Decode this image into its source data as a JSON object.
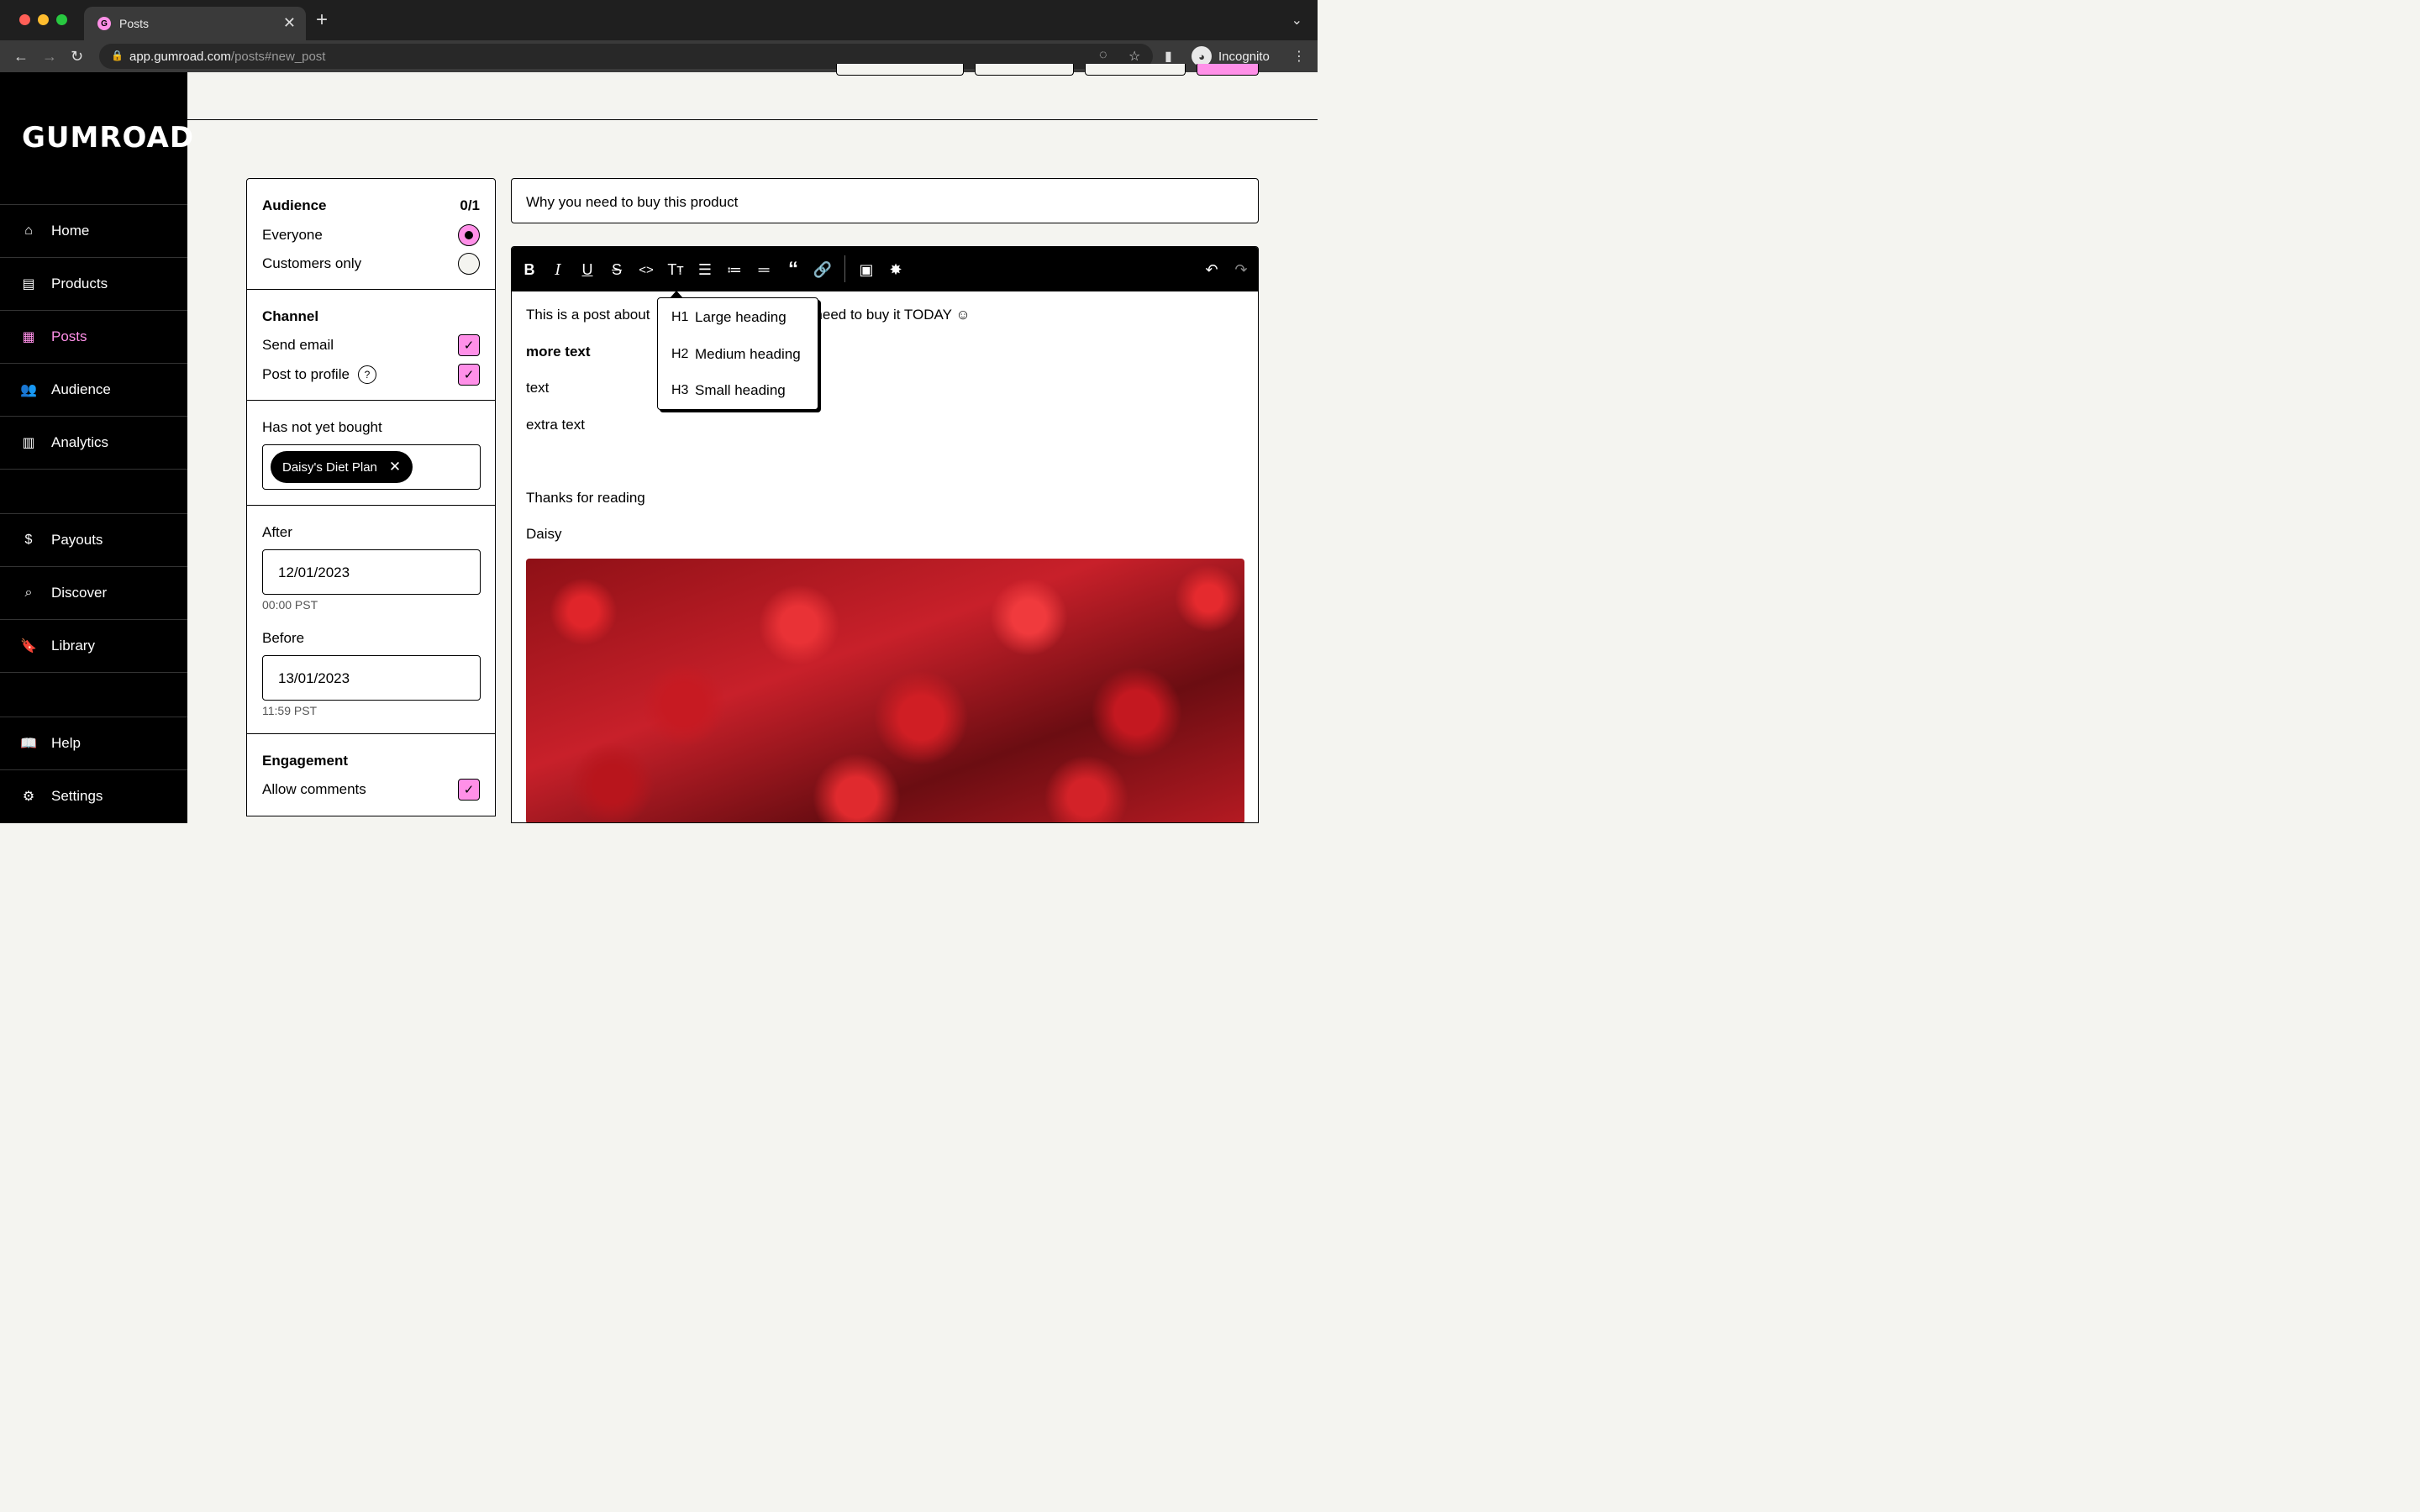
{
  "browser": {
    "tab_title": "Posts",
    "favicon_letter": "G",
    "url_host": "app.gumroad.com",
    "url_path": "/posts#new_post",
    "profile_label": "Incognito"
  },
  "sidebar": {
    "logo": "GUMROAD",
    "items": [
      {
        "label": "Home",
        "icon": "store-icon"
      },
      {
        "label": "Products",
        "icon": "archive-icon"
      },
      {
        "label": "Posts",
        "icon": "document-icon",
        "active": true
      },
      {
        "label": "Audience",
        "icon": "people-icon"
      },
      {
        "label": "Analytics",
        "icon": "bar-chart-icon"
      },
      {
        "label": "Payouts",
        "icon": "dollar-icon"
      },
      {
        "label": "Discover",
        "icon": "search-icon"
      },
      {
        "label": "Library",
        "icon": "bookmark-icon"
      },
      {
        "label": "Help",
        "icon": "book-icon"
      },
      {
        "label": "Settings",
        "icon": "gear-icon"
      }
    ]
  },
  "audience": {
    "title": "Audience",
    "count": "0/1",
    "everyone": "Everyone",
    "customers_only": "Customers only"
  },
  "channel": {
    "title": "Channel",
    "send_email": "Send email",
    "post_to_profile": "Post to profile",
    "help_glyph": "?"
  },
  "filters": {
    "has_not_bought_label": "Has not yet bought",
    "chip": "Daisy's Diet Plan",
    "after_label": "After",
    "after_date": "12/01/2023",
    "after_time": "00:00 PST",
    "before_label": "Before",
    "before_date": "13/01/2023",
    "before_time": "11:59 PST"
  },
  "engagement": {
    "title": "Engagement",
    "allow_comments": "Allow comments"
  },
  "post": {
    "title": "Why you need to buy this product",
    "line1_a": "This is a post about",
    "line1_b": "need to buy it TODAY ☺",
    "line2": "more text",
    "line3": "text",
    "line4": "extra text",
    "line5": "Thanks for reading",
    "line6": "Daisy"
  },
  "heading_menu": {
    "items": [
      {
        "tag": "H1",
        "label": "Large heading"
      },
      {
        "tag": "H2",
        "label": "Medium heading"
      },
      {
        "tag": "H3",
        "label": "Small heading"
      }
    ]
  },
  "colors": {
    "accent": "#ff90e8",
    "sidebar_bg": "#000000",
    "page_bg": "#f4f4f0"
  }
}
